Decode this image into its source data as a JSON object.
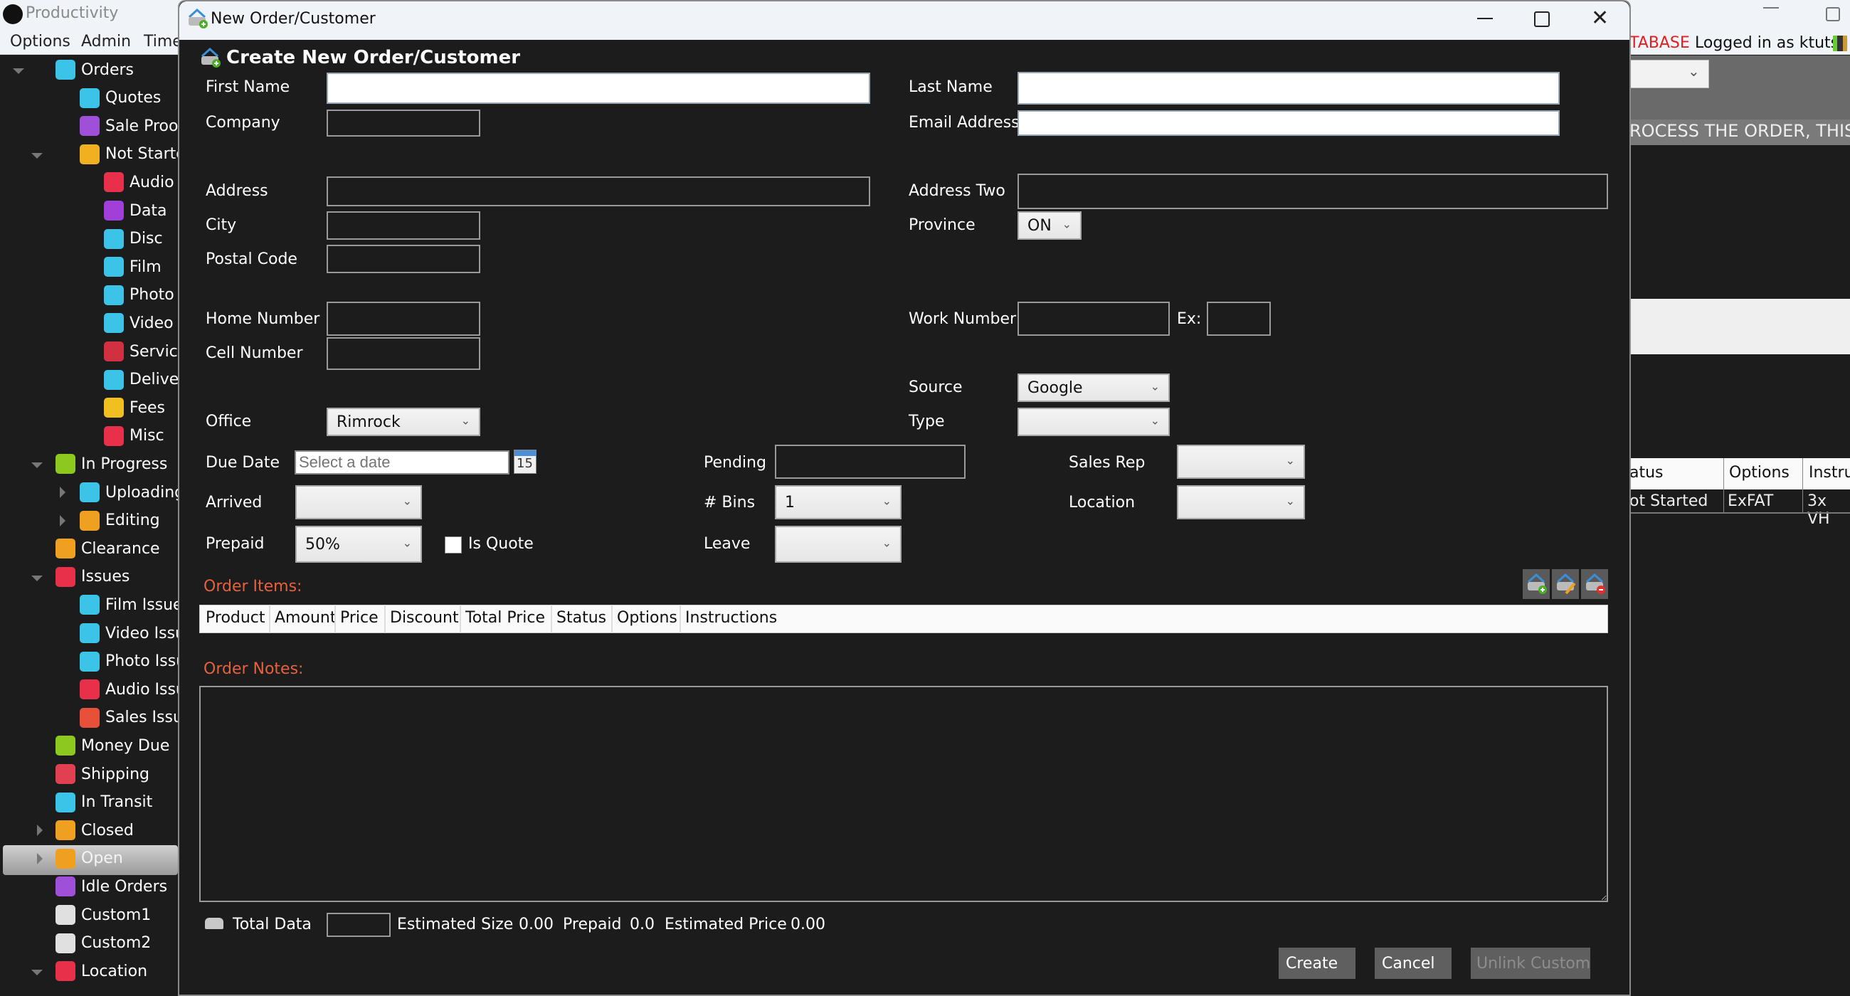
{
  "app": {
    "title": "Productivity",
    "menu": [
      "Options",
      "Admin",
      "Time"
    ],
    "db_warning": "TABASE",
    "logged_in": "Logged in as ktutsu",
    "banner_text": "ROCESS THE ORDER, THIS IS",
    "background_table": {
      "headers": [
        "atus",
        "Options",
        "Instru"
      ],
      "row": [
        "ot Started",
        "ExFAT",
        "3x VH"
      ]
    }
  },
  "sidebar": {
    "items": [
      {
        "label": "Orders",
        "icon": "orders-icon"
      },
      {
        "label": "Quotes",
        "icon": "quotes-icon"
      },
      {
        "label": "Sale Proofing",
        "icon": "sale-proofing-icon"
      },
      {
        "label": "Not Started",
        "icon": "not-started-icon"
      },
      {
        "label": "Audio",
        "icon": "audio-icon"
      },
      {
        "label": "Data",
        "icon": "data-icon"
      },
      {
        "label": "Disc",
        "icon": "disc-icon"
      },
      {
        "label": "Film",
        "icon": "film-icon"
      },
      {
        "label": "Photo",
        "icon": "photo-icon"
      },
      {
        "label": "Video",
        "icon": "video-icon"
      },
      {
        "label": "Service",
        "icon": "service-icon"
      },
      {
        "label": "Delivery",
        "icon": "delivery-icon"
      },
      {
        "label": "Fees",
        "icon": "fees-icon"
      },
      {
        "label": "Misc",
        "icon": "misc-icon"
      },
      {
        "label": "In Progress",
        "icon": "in-progress-icon"
      },
      {
        "label": "Uploading",
        "icon": "uploading-icon"
      },
      {
        "label": "Editing",
        "icon": "editing-icon"
      },
      {
        "label": "Clearance",
        "icon": "clearance-icon"
      },
      {
        "label": "Issues",
        "icon": "issues-icon"
      },
      {
        "label": "Film Issues",
        "icon": "film-issues-icon"
      },
      {
        "label": "Video Issues",
        "icon": "video-issues-icon"
      },
      {
        "label": "Photo Issues",
        "icon": "photo-issues-icon"
      },
      {
        "label": "Audio Issues",
        "icon": "audio-issues-icon"
      },
      {
        "label": "Sales Issues",
        "icon": "sales-issues-icon"
      },
      {
        "label": "Money Due",
        "icon": "money-due-icon"
      },
      {
        "label": "Shipping",
        "icon": "shipping-icon"
      },
      {
        "label": "In Transit",
        "icon": "in-transit-icon"
      },
      {
        "label": "Closed",
        "icon": "closed-icon"
      },
      {
        "label": "Open",
        "icon": "open-icon"
      },
      {
        "label": "Idle Orders",
        "icon": "idle-orders-icon"
      },
      {
        "label": "Custom1",
        "icon": "custom1-icon"
      },
      {
        "label": "Custom2",
        "icon": "custom2-icon"
      },
      {
        "label": "Location",
        "icon": "location-icon"
      }
    ],
    "selected": "Open"
  },
  "dialog": {
    "window_title": "New Order/Customer",
    "header": "Create New Order/Customer",
    "labels": {
      "first_name": "First Name",
      "last_name": "Last Name",
      "company": "Company",
      "email": "Email Address",
      "address": "Address",
      "address_two": "Address Two",
      "city": "City",
      "province": "Province",
      "postal_code": "Postal Code",
      "home_number": "Home Number",
      "work_number": "Work Number",
      "ex": "Ex:",
      "cell_number": "Cell Number",
      "source": "Source",
      "type": "Type",
      "office": "Office",
      "due_date": "Due Date",
      "pending": "Pending",
      "sales_rep": "Sales Rep",
      "arrived": "Arrived",
      "bins": "# Bins",
      "location": "Location",
      "prepaid": "Prepaid",
      "is_quote": "Is Quote",
      "leave": "Leave"
    },
    "values": {
      "first_name": "",
      "last_name": "",
      "company": "",
      "email": "",
      "address": "",
      "address_two": "",
      "city": "",
      "province": "ON",
      "postal_code": "",
      "home_number": "",
      "work_number": "",
      "ex": "",
      "cell_number": "",
      "source": "Google",
      "type": "",
      "office": "Rimrock",
      "due_date_placeholder": "Select a date",
      "calendar_day": "15",
      "pending": "",
      "sales_rep": "",
      "arrived": "",
      "bins": "1",
      "location": "",
      "prepaid": "50%",
      "is_quote": false,
      "leave": ""
    },
    "order_items": {
      "title": "Order Items:",
      "columns": [
        "Product",
        "Amount",
        "Price",
        "Discount",
        "Total Price",
        "Status",
        "Options",
        "Instructions"
      ],
      "rows": [],
      "tools": [
        "add-item",
        "edit-item",
        "remove-item"
      ]
    },
    "order_notes": {
      "title": "Order Notes:",
      "value": ""
    },
    "summary": {
      "total_data_label": "Total Data",
      "total_data_value": "",
      "estimated_size_label": "Estimated Size",
      "estimated_size_value": "0.00",
      "prepaid_label": "Prepaid",
      "prepaid_value": "0.0",
      "estimated_price_label": "Estimated Price",
      "estimated_price_value": "0.00"
    },
    "buttons": {
      "create": "Create",
      "cancel": "Cancel",
      "unlink": "Unlink Customer"
    }
  },
  "colors": {
    "background": "#1c1c1c",
    "section_title": "#e8603c",
    "db_warning": "#e02020",
    "button": "#5f5f5f"
  }
}
